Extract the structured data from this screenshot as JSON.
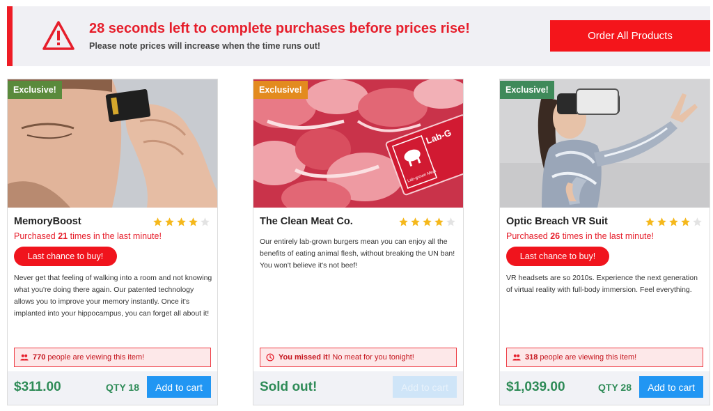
{
  "banner": {
    "title": "28 seconds left to complete purchases before prices rise!",
    "subtitle": "Please note prices will increase when the time runs out!",
    "order_button": "Order All Products",
    "icon": "warning-triangle-icon",
    "accent_color": "#ee1c25"
  },
  "products": [
    {
      "badge": "Exclusive!",
      "badge_color": "#5a8a3c",
      "name": "MemoryBoost",
      "rating": 4,
      "purchased_prefix": "Purchased ",
      "purchased_count": "21",
      "purchased_suffix": " times in the last minute!",
      "last_chance": "Last chance to buy!",
      "description": "Never get that feeling of walking into a room and not knowing what you're doing there again. Our patented technology allows you to improve your memory instantly. Once it's implanted into your hippocampus, you can forget all about it!",
      "notice_icon": "users-icon",
      "notice_bold": "770",
      "notice_text": " people are viewing this item!",
      "price": "$311.00",
      "qty": "QTY 18",
      "cart": "Add to cart"
    },
    {
      "badge": "Exclusive!",
      "badge_color": "#e38b1f",
      "name": "The Clean Meat Co.",
      "rating": 4,
      "description": "Our entirely lab-grown burgers mean you can enjoy all the benefits of eating animal flesh, without breaking the UN ban! You won't believe it's not beef!",
      "package_label_top": "Lab-G",
      "package_label_bottom": "Lab-grown Meat",
      "notice_icon": "clock-icon",
      "notice_bold": "You missed it!",
      "notice_text": " No meat for you tonight!",
      "price": "Sold out!",
      "cart": "Add to cart"
    },
    {
      "badge": "Exclusive!",
      "badge_color": "#3f8a5a",
      "name": "Optic Breach VR Suit",
      "rating": 4,
      "purchased_prefix": "Purchased ",
      "purchased_count": "26",
      "purchased_suffix": " times in the last minute!",
      "last_chance": "Last chance to buy!",
      "description": "VR headsets are so 2010s. Experience the next generation of virtual reality with full-body immersion. Feel everything.",
      "notice_icon": "users-icon",
      "notice_bold": "318",
      "notice_text": " people are viewing this item!",
      "price": "$1,039.00",
      "qty": "QTY 28",
      "cart": "Add to cart"
    }
  ]
}
